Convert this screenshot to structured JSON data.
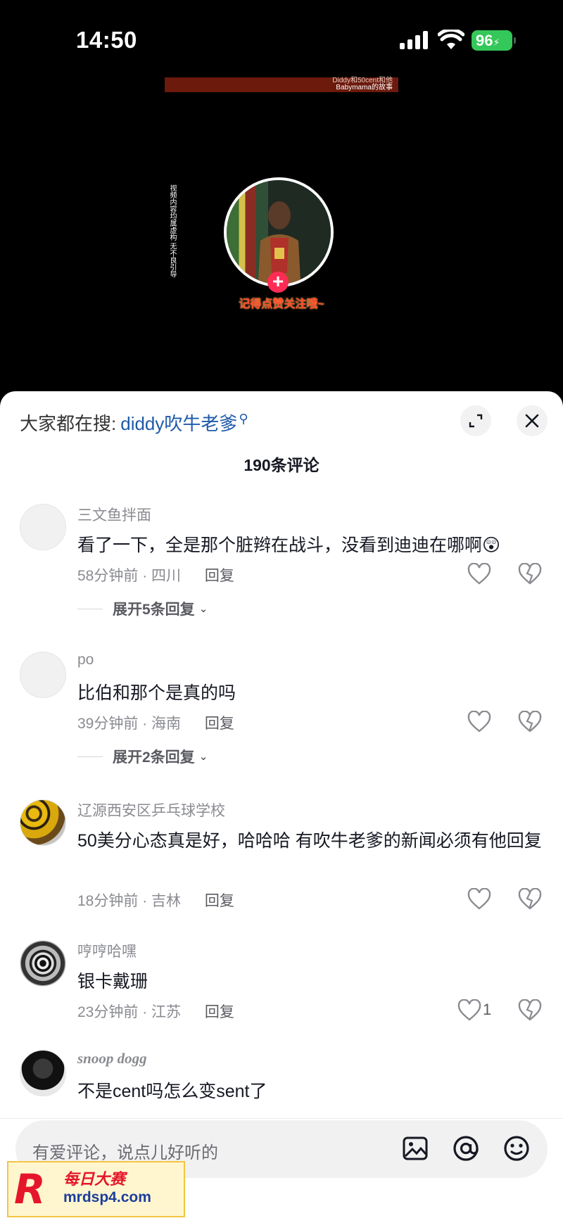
{
  "status_bar": {
    "time": "14:50",
    "battery": "96"
  },
  "video": {
    "banner_text_1": "Diddy和50cent和他",
    "banner_text_2": "Babymama的故事",
    "vertical_notice": "视频内容均属虚构   无不良引导",
    "follow_text": "记得点赞关注哦~",
    "plus": "+"
  },
  "sheet": {
    "search_prefix": "大家都在搜:",
    "search_term": "diddy吹牛老爹",
    "comment_count": "190条评论"
  },
  "comments": [
    {
      "user": "三文鱼拌面",
      "text": "看了一下，全是那个脏辫在战斗，没看到迪迪在哪啊😲",
      "time_loc": "58分钟前 · 四川",
      "reply": "回复",
      "likes": "",
      "expand": "展开5条回复"
    },
    {
      "user": "po",
      "text": "比伯和那个是真的吗",
      "time_loc": "39分钟前 · 海南",
      "reply": "回复",
      "likes": "",
      "expand": "展开2条回复"
    },
    {
      "user": "辽源西安区乒乓球学校",
      "text": "50美分心态真是好，哈哈哈 有吹牛老爹的新闻必须有他回复",
      "time_loc": "18分钟前 · 吉林",
      "reply": "回复",
      "likes": ""
    },
    {
      "user": "哼哼哈嘿",
      "text": "银卡戴珊",
      "time_loc": "23分钟前 · 江苏",
      "reply": "回复",
      "likes": "1"
    },
    {
      "user": "snoop dogg",
      "text": "不是cent吗怎么变sent了",
      "time_loc": "",
      "reply": "",
      "likes": ""
    }
  ],
  "input": {
    "placeholder": "有爱评论，说点儿好听的"
  },
  "icons": [
    "signal-icon",
    "wifi-icon",
    "battery-icon",
    "expand-icon",
    "close-icon",
    "heart-icon",
    "broken-heart-icon",
    "image-icon",
    "at-icon",
    "emoji-icon",
    "chevron-down-icon"
  ],
  "colors": {
    "accent_red": "#fe2c55",
    "link_blue": "#1f5aa8",
    "battery_green": "#34c759"
  },
  "watermark": {
    "logo": "R",
    "title": "每日大赛",
    "url": "mrdsp4.com"
  }
}
